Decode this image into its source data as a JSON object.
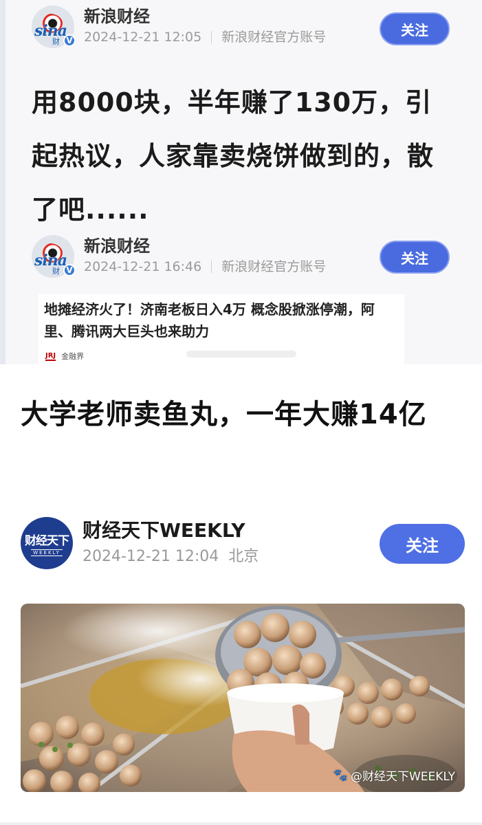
{
  "post1": {
    "account_name": "新浪财经",
    "timestamp": "2024-12-21 12:05",
    "account_type": "新浪财经官方账号",
    "follow_label": "关注",
    "logo_text": "sina",
    "logo_sub": "财",
    "verified_mark": "V",
    "headline": "用8000块，半年赚了130万，引起热议，人家靠卖烧饼做到的，散了吧......"
  },
  "post2": {
    "account_name": "新浪财经",
    "timestamp": "2024-12-21 16:46",
    "account_type": "新浪财经官方账号",
    "follow_label": "关注",
    "logo_text": "sina",
    "logo_sub": "财",
    "verified_mark": "V",
    "news_title": "地摊经济火了！济南老板日入4万 概念股掀涨停潮，阿里、腾讯两大巨头也来助力",
    "news_source": "金融界"
  },
  "article": {
    "headline": "大学老师卖鱼丸，一年大赚14亿",
    "author_name": "财经天下WEEKLY",
    "timestamp": "2024-12-21 12:04",
    "location": "北京",
    "follow_label": "关注",
    "logo_text": "财经天下",
    "logo_sub": "WEEKLY",
    "image_watermark": "@财经天下WEEKLY"
  },
  "colors": {
    "follow_button": "#4f6fe4",
    "logo_cj_bg": "#1f3d8f",
    "sina_blue": "#1a5fb4"
  }
}
